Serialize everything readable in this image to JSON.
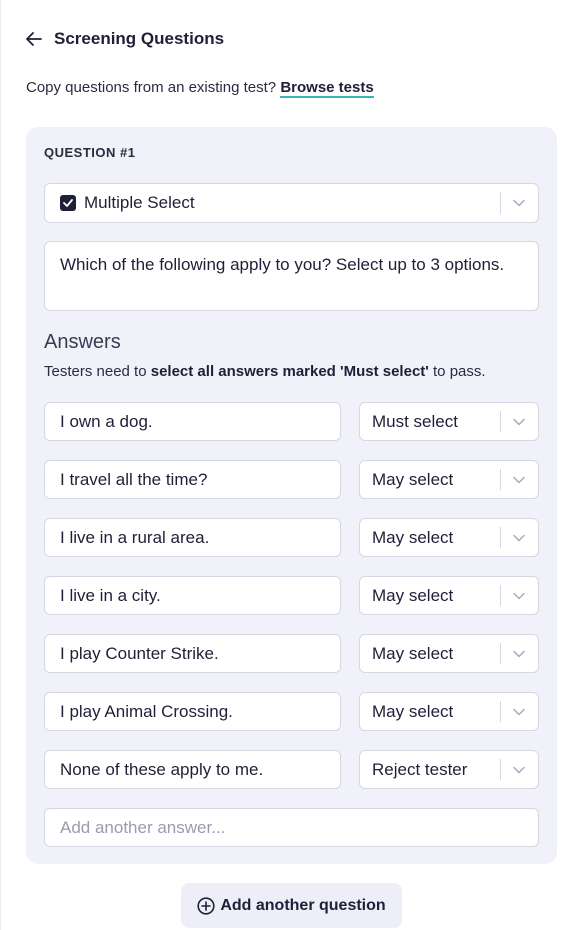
{
  "header": {
    "title": "Screening Questions"
  },
  "copy": {
    "prompt": "Copy questions from an existing test?",
    "link_label": "Browse tests"
  },
  "question": {
    "label": "QUESTION #1",
    "type": "Multiple Select",
    "text": "Which of the following apply to you? Select up to 3 options."
  },
  "answers": {
    "title": "Answers",
    "help_prefix": "Testers need to ",
    "help_bold": "select all answers marked 'Must select'",
    "help_suffix": " to pass.",
    "items": [
      {
        "text": "I own a dog.",
        "rule": "Must select"
      },
      {
        "text": "I travel all the time?",
        "rule": "May select"
      },
      {
        "text": "I live in a rural area.",
        "rule": "May select"
      },
      {
        "text": "I live in a city.",
        "rule": "May select"
      },
      {
        "text": "I play Counter Strike.",
        "rule": "May select"
      },
      {
        "text": "I play Animal Crossing.",
        "rule": "May select"
      },
      {
        "text": "None of these apply to me.",
        "rule": "Reject tester"
      }
    ],
    "add_placeholder": "Add another answer..."
  },
  "footer": {
    "add_question_label": "Add another question"
  },
  "colors": {
    "accent_underline": "#38b6b0",
    "card_bg": "#f1f1fa",
    "text_dark": "#1f2037"
  },
  "icons": {
    "back": "arrow-left-icon",
    "checkbox": "checkbox-checked-icon",
    "chevron": "chevron-down-icon",
    "add": "plus-circle-icon"
  }
}
